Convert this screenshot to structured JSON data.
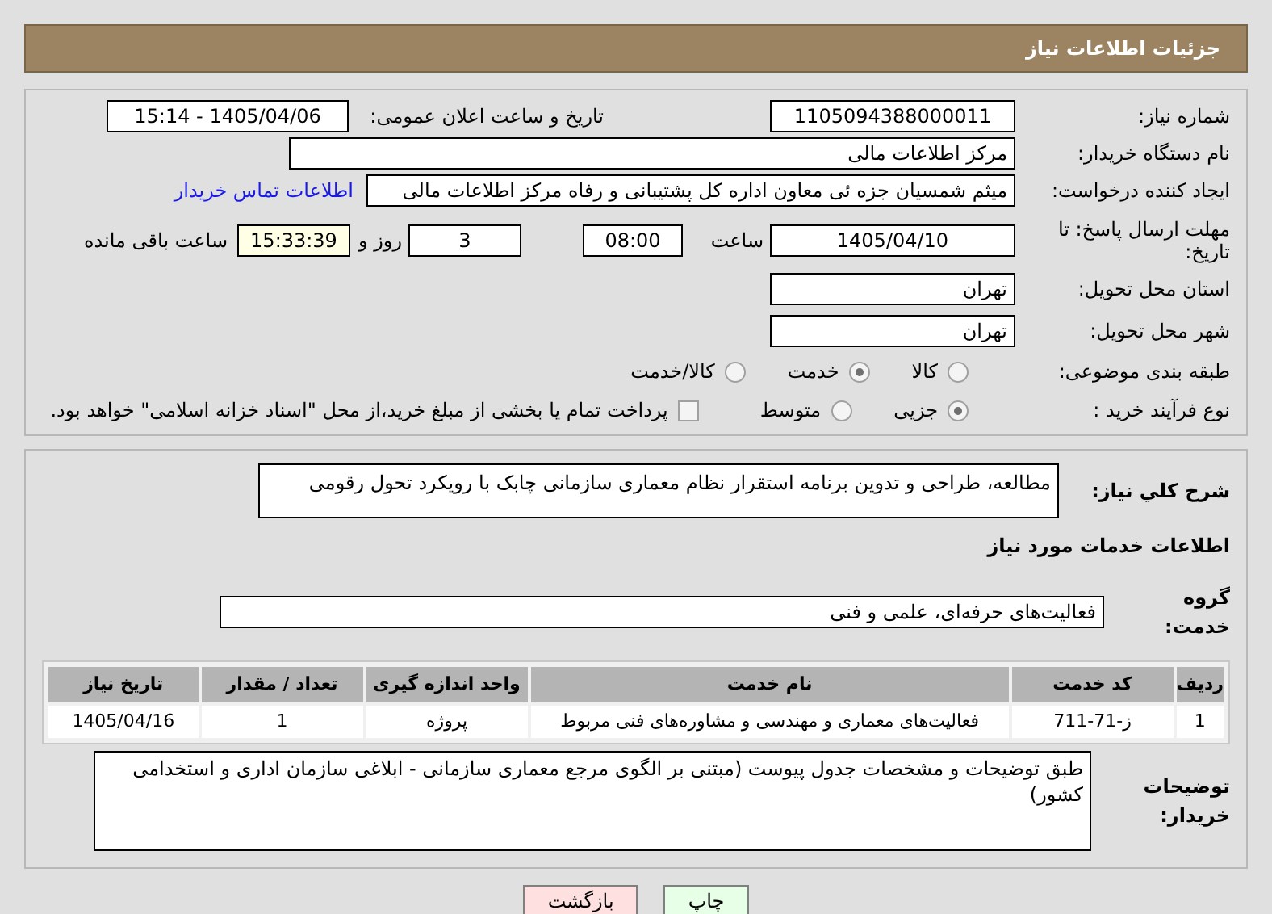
{
  "header": {
    "title": "جزئیات اطلاعات نیاز"
  },
  "need_number": {
    "label": "شماره نیاز:",
    "value": "1105094388000011"
  },
  "announce": {
    "label": "تاریخ و ساعت اعلان عمومی:",
    "value": "1405/04/06 - 15:14"
  },
  "buyer_org": {
    "label": "نام دستگاه خریدار:",
    "value": "مرکز اطلاعات مالی"
  },
  "requester": {
    "label": "ایجاد کننده درخواست:",
    "value": "میثم شمسیان جزه ئی معاون اداره کل پشتیبانی و رفاه مرکز اطلاعات مالی",
    "link": "اطلاعات تماس خریدار"
  },
  "deadline": {
    "label": "مهلت ارسال پاسخ: تا تاریخ:",
    "date": "1405/04/10",
    "time_label": "ساعت",
    "time": "08:00",
    "days": "3",
    "days_label": "روز و",
    "remaining": "15:33:39",
    "remaining_label": "ساعت باقی مانده"
  },
  "province": {
    "label": "استان محل تحویل:",
    "value": "تهران"
  },
  "city": {
    "label": "شهر محل تحویل:",
    "value": "تهران"
  },
  "category": {
    "label": "طبقه بندی موضوعی:",
    "options": [
      {
        "label": "کالا",
        "selected": false
      },
      {
        "label": "خدمت",
        "selected": true
      },
      {
        "label": "کالا/خدمت",
        "selected": false
      }
    ]
  },
  "purchase_type": {
    "label": "نوع فرآیند خرید :",
    "options": [
      {
        "label": "جزیی",
        "selected": true
      },
      {
        "label": "متوسط",
        "selected": false
      }
    ],
    "treasury": {
      "checked": false,
      "text": "پرداخت تمام یا بخشی از مبلغ خرید،از محل \"اسناد خزانه اسلامی\" خواهد بود."
    }
  },
  "description": {
    "label": "شرح کلي نیاز:",
    "value": "مطالعه، طراحی و تدوین برنامه استقرار نظام معماری سازمانی چابک با رویکرد تحول رقومی"
  },
  "services_title": "اطلاعات خدمات مورد نیاز",
  "service_group": {
    "label": "گروه خدمت:",
    "value": "فعالیت‌های حرفه‌ای، علمی و فنی"
  },
  "table": {
    "columns": [
      "ردیف",
      "کد خدمت",
      "نام خدمت",
      "واحد اندازه گیری",
      "تعداد / مقدار",
      "تاریخ نیاز"
    ],
    "rows": [
      [
        "1",
        "ز-71-711",
        "فعالیت‌های معماری و مهندسی و مشاوره‌های فنی مربوط",
        "پروژه",
        "1",
        "1405/04/16"
      ]
    ]
  },
  "buyer_notes": {
    "label": "توضیحات خریدار:",
    "value": "طبق توضیحات و مشخصات جدول پیوست (مبتنی بر الگوی مرجع معماری سازمانی - ابلاغی سازمان اداری و استخدامی کشور)"
  },
  "buttons": [
    {
      "label": "چاپ",
      "kind": "print"
    },
    {
      "label": "بازگشت",
      "kind": "back"
    }
  ]
}
